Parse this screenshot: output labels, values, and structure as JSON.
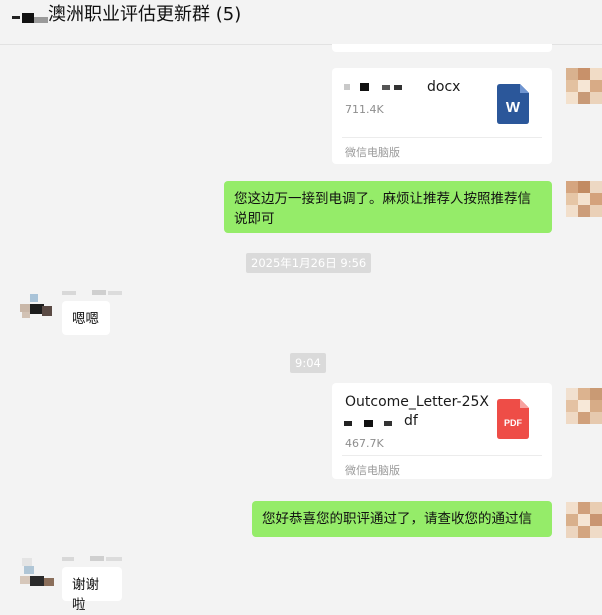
{
  "window": {
    "title": "澳洲职业评估更新群 (5)"
  },
  "messages": {
    "file1": {
      "name_visible": "docx",
      "size": "711.4K",
      "source": "微信电脑版",
      "icon": "word-icon",
      "icon_letter": "W",
      "icon_color": "#2b579a"
    },
    "text1": {
      "content": "您这边万一接到电调了。麻烦让推荐人按照推荐信说即可"
    },
    "time1": "2025年1月26日 9:56",
    "reply1": {
      "content": "嗯嗯"
    },
    "time2": "9:04",
    "file2": {
      "name": "Outcome_Letter-25X",
      "name_suffix": "df",
      "size": "467.7K",
      "source": "微信电脑版",
      "icon": "pdf-icon",
      "icon_label": "PDF",
      "icon_color": "#e74c3c"
    },
    "text2": {
      "content": "您好恭喜您的职评通过了，请查收您的通过信"
    },
    "reply2": {
      "content": "谢谢啦"
    }
  },
  "colors": {
    "own_bubble": "#95ec69",
    "other_bubble": "#ffffff",
    "background": "#f3f3f3"
  }
}
